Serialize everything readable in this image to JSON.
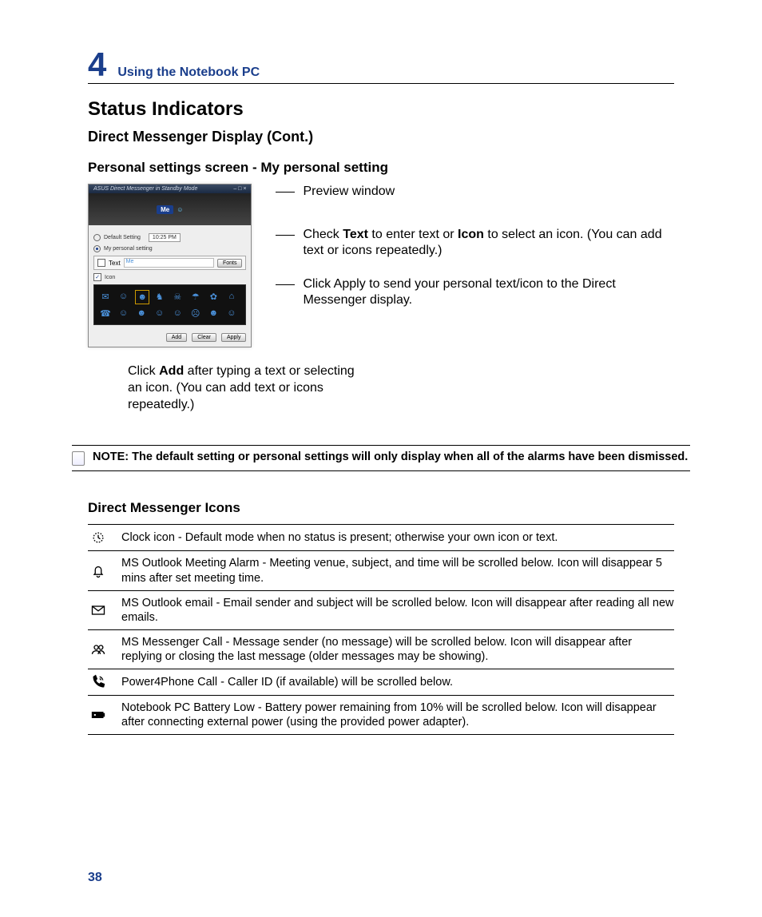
{
  "chapter": {
    "number": "4",
    "title": "Using the Notebook PC"
  },
  "heading": "Status Indicators",
  "subheading": "Direct Messenger Display (Cont.)",
  "section": "Personal settings screen - My personal setting",
  "screenshot": {
    "titlebar": "ASUS Direct Messenger in Standby Mode",
    "preview_label": "Me",
    "default_setting_label": "Default Setting",
    "time": "10:25 PM",
    "personal_setting_label": "My personal setting",
    "text_label": "Text",
    "text_field": "Me",
    "fonts_btn": "Fonts",
    "icon_label": "Icon",
    "add_btn": "Add",
    "clear_btn": "Clear",
    "apply_btn": "Apply"
  },
  "callouts": {
    "preview": "Preview window",
    "text_icon_pre": "Check ",
    "text_icon_b1": "Text",
    "text_icon_mid": " to enter text or ",
    "text_icon_b2": "Icon",
    "text_icon_post": " to select an icon. (You can add text or icons repeatedly.)",
    "apply": "Click Apply to send your personal text/icon to the Direct Messenger display.",
    "add_pre": "Click ",
    "add_b": "Add",
    "add_post": " after typing a text or selecting an icon. (You can add text or icons repeatedly.)"
  },
  "note": "NOTE: The default setting or personal settings will only display when all of the alarms have been dismissed.",
  "icons_heading": "Direct Messenger Icons",
  "icons": [
    {
      "name": "clock-icon",
      "desc": "Clock icon - Default mode when no status is present; otherwise your own icon or text."
    },
    {
      "name": "bell-icon",
      "desc": "MS Outlook Meeting Alarm - Meeting venue, subject, and time will be scrolled below. Icon will disappear 5 mins after set meeting time."
    },
    {
      "name": "mail-icon",
      "desc": "MS Outlook email - Email sender and subject will be scrolled below. Icon will disappear after reading all new emails."
    },
    {
      "name": "people-icon",
      "desc": "MS Messenger Call - Message sender (no message) will be scrolled below. Icon will disappear after replying or closing the last message (older messages may be showing)."
    },
    {
      "name": "phone-icon",
      "desc": "Power4Phone Call - Caller ID (if available) will be scrolled below."
    },
    {
      "name": "battery-icon",
      "desc": "Notebook PC Battery Low - Battery power remaining from 10% will be scrolled below. Icon will disappear after connecting external power (using the provided power adapter)."
    }
  ],
  "page_number": "38"
}
